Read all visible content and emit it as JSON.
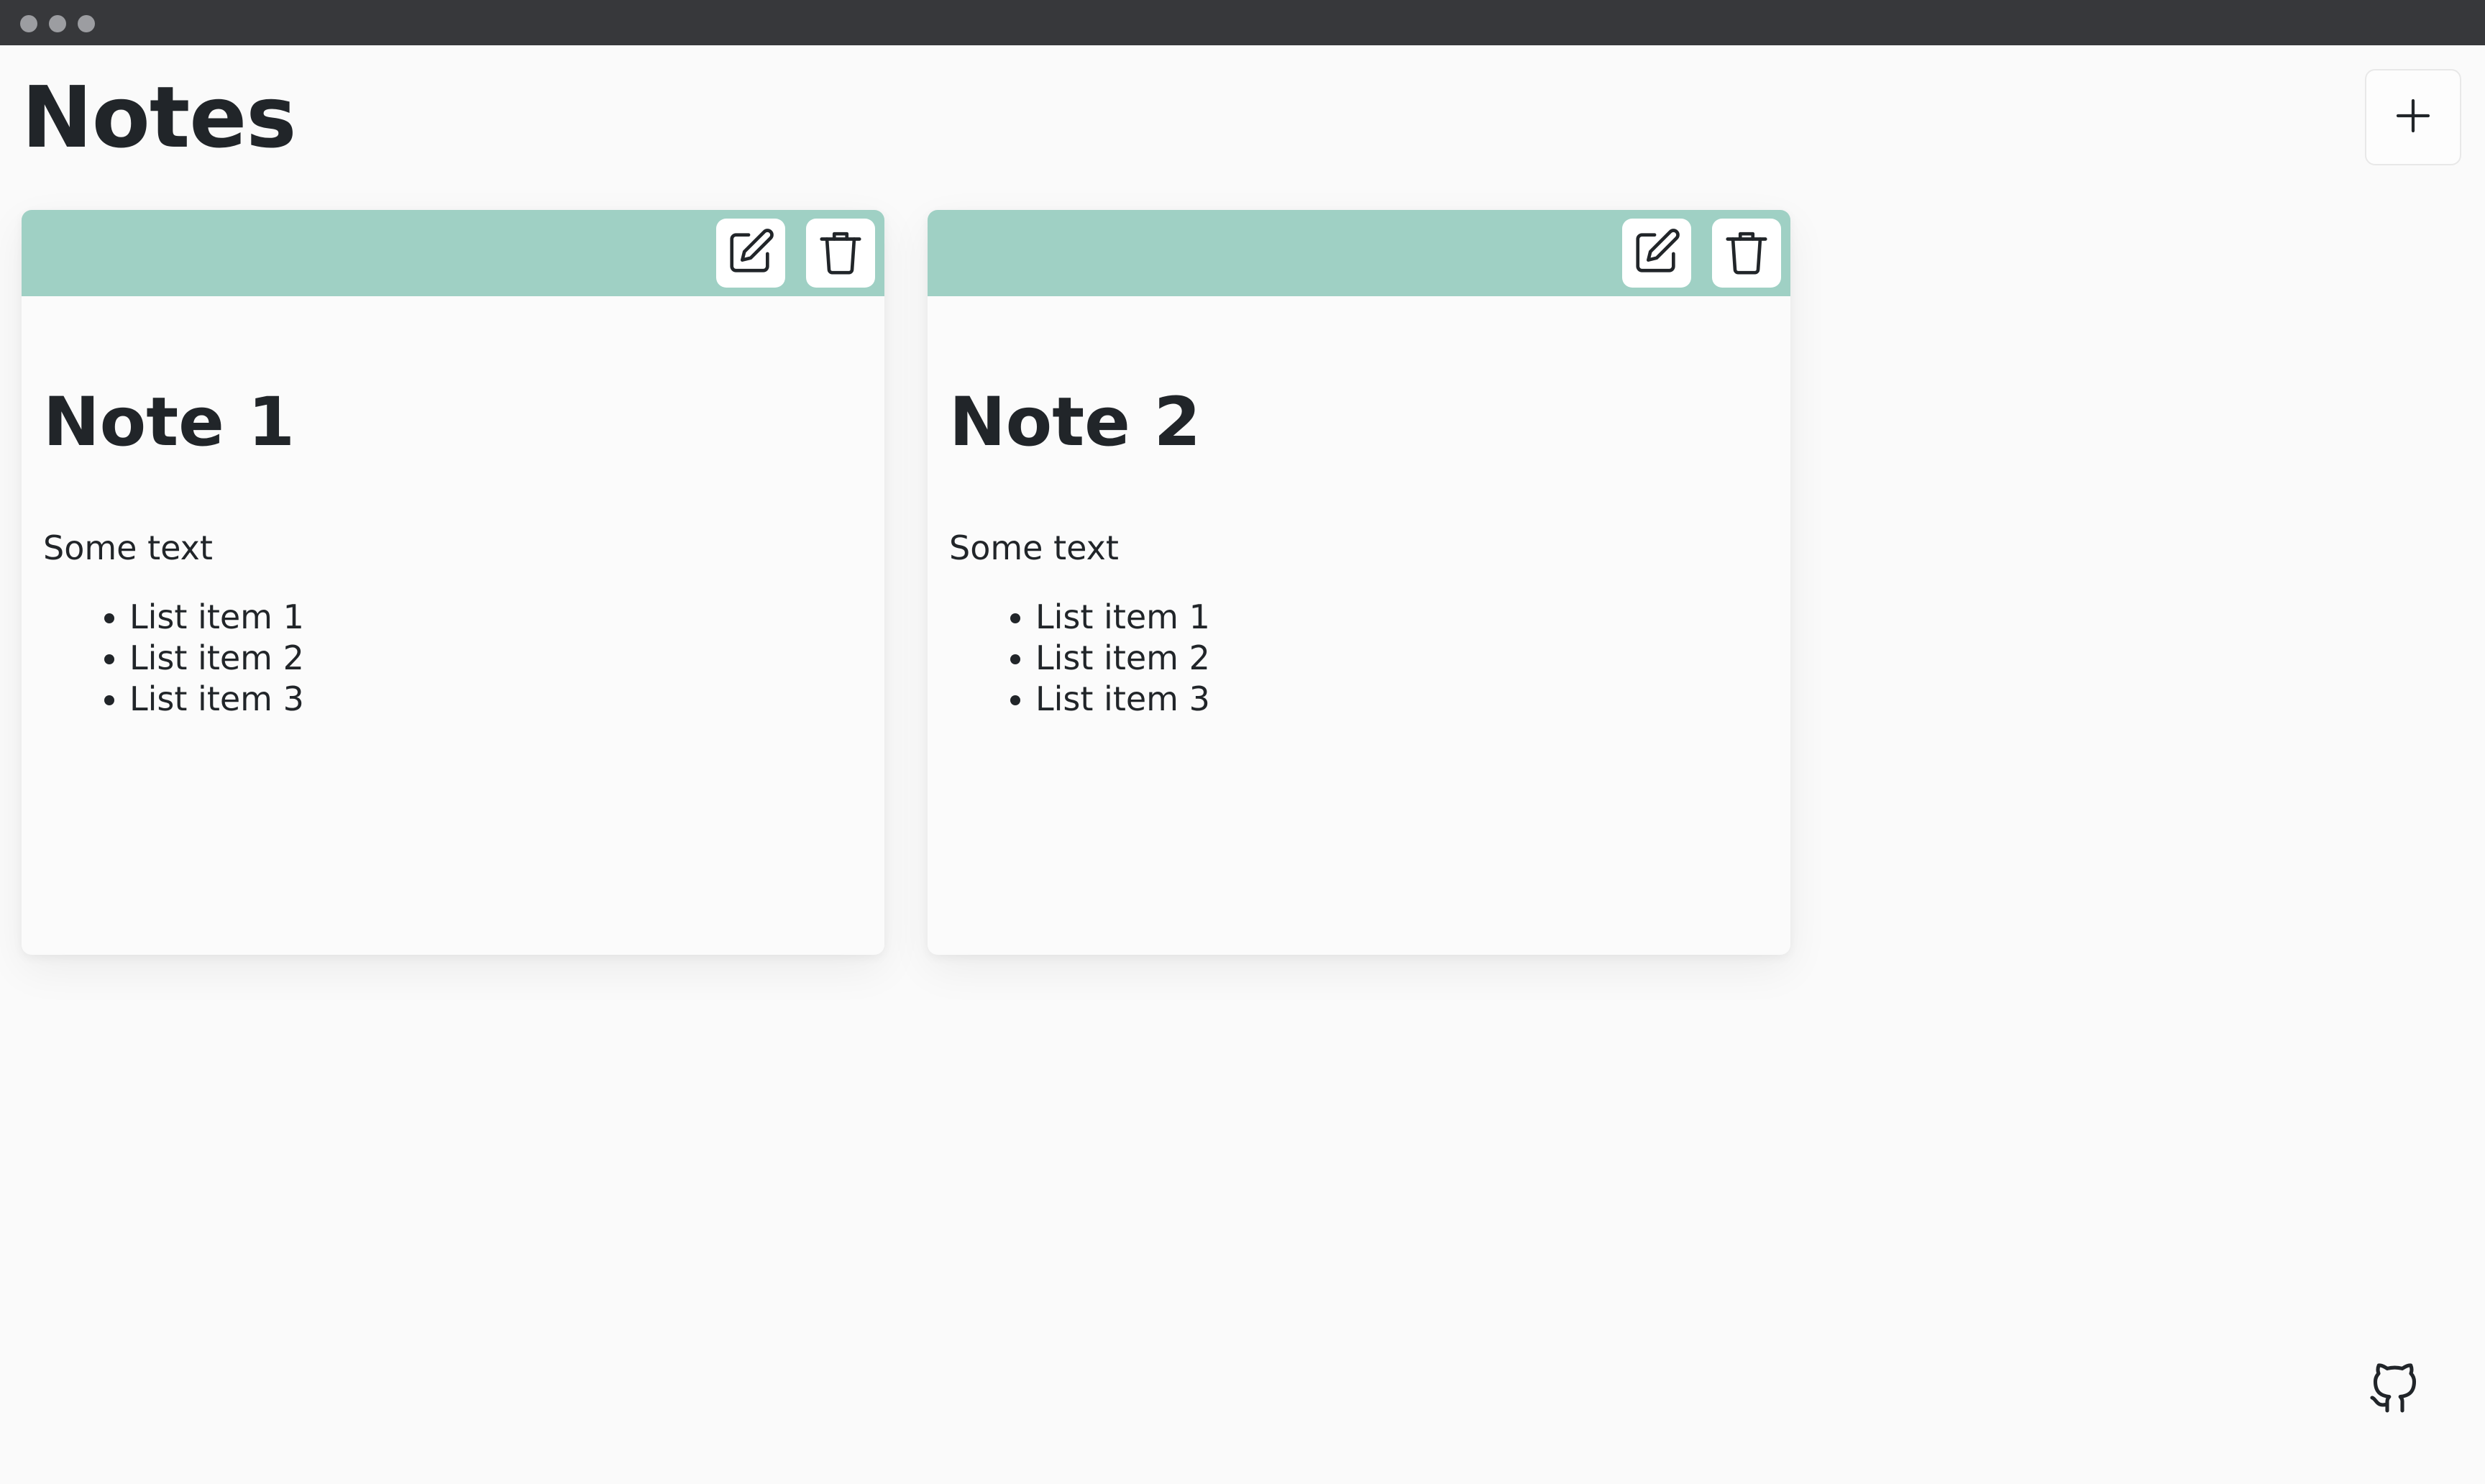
{
  "window": {
    "controls": [
      "window-dot-1",
      "window-dot-2",
      "window-dot-3"
    ]
  },
  "header": {
    "title": "Notes",
    "add_button_icon": "plus-icon"
  },
  "notes": [
    {
      "title": "Note 1",
      "text": "Some text",
      "items": [
        "List item 1",
        "List item 2",
        "List item 3"
      ],
      "header_color": "#9fd0c4",
      "actions": [
        "edit-icon",
        "trash-icon"
      ]
    },
    {
      "title": "Note 2",
      "text": "Some text",
      "items": [
        "List item 1",
        "List item 2",
        "List item 3"
      ],
      "header_color": "#9fd0c4",
      "actions": [
        "edit-icon",
        "trash-icon"
      ]
    }
  ],
  "footer": {
    "link_icon": "github-icon"
  },
  "colors": {
    "titlebar": "#37383b",
    "background": "#fafafa",
    "accent": "#9fd0c4",
    "text": "#212529"
  }
}
